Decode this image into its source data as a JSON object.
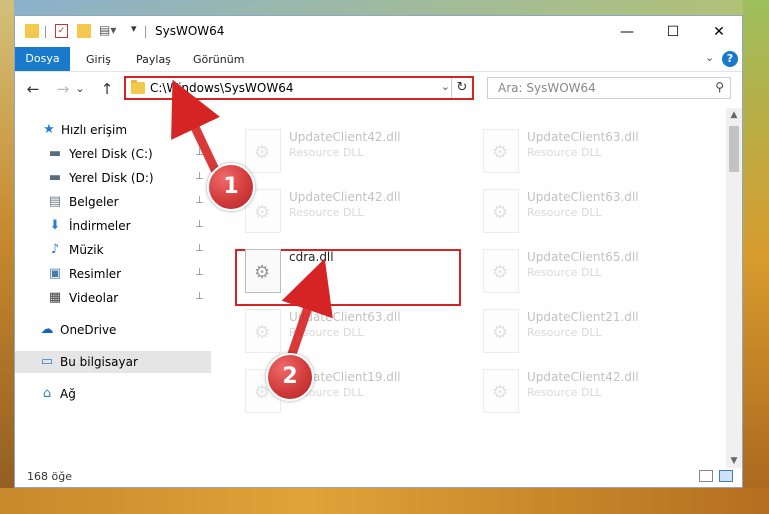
{
  "window": {
    "title": "SysWOW64",
    "controls": {
      "minimize": "—",
      "maximize": "☐",
      "close": "✕"
    }
  },
  "ribbon": {
    "tabs": [
      "Dosya",
      "Giriş",
      "Paylaş",
      "Görünüm"
    ],
    "active_tab": "Dosya",
    "expand_glyph": "⌄",
    "help": "?"
  },
  "navigation": {
    "back": "←",
    "forward": "→",
    "recent": "⌄",
    "up": "↑",
    "address": "C:\\Windows\\SysWOW64",
    "search_placeholder": "Ara: SysWOW64"
  },
  "sidebar": {
    "items": [
      {
        "label": "Hızlı erişim",
        "icon": "star-icon",
        "glyph": "★",
        "color": "#2b7cd3",
        "pinned": false
      },
      {
        "label": "Yerel Disk (C:)",
        "icon": "drive-icon",
        "glyph": "▬",
        "color": "#5b6d7d",
        "pinned": true
      },
      {
        "label": "Yerel Disk (D:)",
        "icon": "drive-icon",
        "glyph": "▬",
        "color": "#5b6d7d",
        "pinned": true
      },
      {
        "label": "Belgeler",
        "icon": "documents-icon",
        "glyph": "▤",
        "color": "#6c7a89",
        "pinned": true
      },
      {
        "label": "İndirmeler",
        "icon": "download-icon",
        "glyph": "⬇",
        "color": "#2b7cd3",
        "pinned": true
      },
      {
        "label": "Müzik",
        "icon": "music-icon",
        "glyph": "♪",
        "color": "#2b7cd3",
        "pinned": true
      },
      {
        "label": "Resimler",
        "icon": "pictures-icon",
        "glyph": "▣",
        "color": "#4a7aa8",
        "pinned": true
      },
      {
        "label": "Videolar",
        "icon": "video-icon",
        "glyph": "▦",
        "color": "#3b3b3b",
        "pinned": true
      },
      {
        "label": "OneDrive",
        "icon": "cloud-icon",
        "glyph": "☁",
        "color": "#1565c0",
        "pinned": false
      },
      {
        "label": "Bu bilgisayar",
        "icon": "computer-icon",
        "glyph": "▭",
        "color": "#2f80c8",
        "pinned": false
      },
      {
        "label": "Ağ",
        "icon": "network-icon",
        "glyph": "⌂",
        "color": "#2f80c8",
        "pinned": false
      }
    ],
    "pin_glyph": "📌",
    "selected_index": 9
  },
  "files": [
    {
      "name": "UpdateClient42.dll",
      "type": "Resource DLL",
      "ghost": true
    },
    {
      "name": "UpdateClient63.dll",
      "type": "Resource DLL",
      "ghost": true
    },
    {
      "name": "UpdateClient42.dll",
      "type": "Resource DLL",
      "ghost": true
    },
    {
      "name": "UpdateClient63.dll",
      "type": "Resource DLL",
      "ghost": true
    },
    {
      "name": "cdra.dll",
      "type": "",
      "ghost": false
    },
    {
      "name": "UpdateClient65.dll",
      "type": "Resource DLL",
      "ghost": true
    },
    {
      "name": "UpdateClient63.dll",
      "type": "Resource DLL",
      "ghost": true
    },
    {
      "name": "UpdateClient21.dll",
      "type": "Resource DLL",
      "ghost": true
    },
    {
      "name": "UpdateClient19.dll",
      "type": "Resource DLL",
      "ghost": true
    },
    {
      "name": "UpdateClient42.dll",
      "type": "Resource DLL",
      "ghost": true
    }
  ],
  "status": {
    "item_count": "168 öğe"
  },
  "scrollbar": {
    "up": "▲",
    "down": "▼"
  },
  "annotations": {
    "step1": "1",
    "step2": "2",
    "color": "#d62424"
  }
}
